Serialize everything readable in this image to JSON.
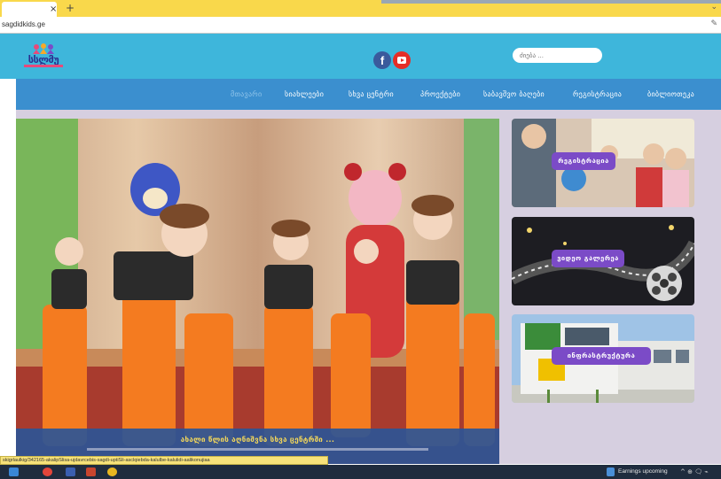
{
  "browser": {
    "tab_close_glyph": "×",
    "new_tab_glyph": "+",
    "dropdown_glyph": "⌄",
    "address": "sagdidkids.ge",
    "edit_icon_glyph": "✎",
    "status_url": "skigrlaulkig/342165-akalipSlisa-ujdavrcebis-sagdi-uptiSli-asclqiebda-kalulbe-kalulidi-aalikonujiaa"
  },
  "site": {
    "logo_text": "სსლმუ",
    "facebook_glyph": "f",
    "search_placeholder": "ძიება ...",
    "nav": [
      "მთავარი",
      "სიახლეები",
      "სხვა ცენტრი",
      "პროექტები",
      "საბავშვო ბაღები",
      "რეგისტრაცია",
      "ბიბლიოთეკა"
    ],
    "hero_caption": "ახალი წლის აღნიშვნა სხვა ცენტრში ...",
    "cards": [
      {
        "label": "რეგისტრაცია"
      },
      {
        "label": "ვიდეო გალერეა"
      },
      {
        "label": "ინფრასტრუქტურა"
      }
    ]
  },
  "taskbar": {
    "weather_text": "Earnings upcoming",
    "tray_text": "^ ⊕ 🗨 ⌁"
  },
  "colors": {
    "header_bg": "#3eb6db",
    "nav_bg": "#3b8fcf",
    "card_label_bg": "#7b4bc7",
    "tabbar_bg": "#f9d84b",
    "main_bg": "#d6cfe0"
  }
}
